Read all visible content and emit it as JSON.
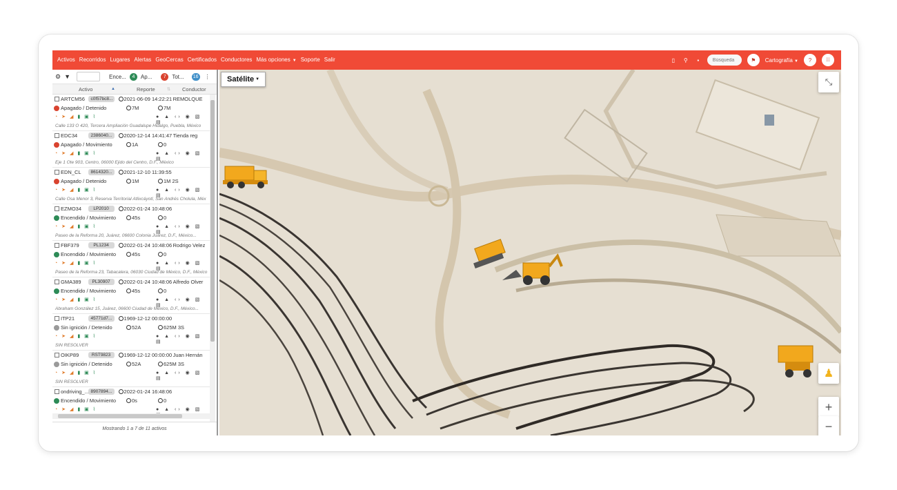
{
  "menu": {
    "items": [
      "Activos",
      "Recorridos",
      "Lugares",
      "Alertas",
      "GeoCercas",
      "Certificados",
      "Conductores",
      "Más opciones",
      "Soporte",
      "Salir"
    ],
    "search_placeholder": "Búsqueda",
    "cartografia": "Cartografía"
  },
  "filters": {
    "encendidos_label": "Ence...",
    "encendidos_count": "4",
    "apagados_label": "Ap...",
    "apagados_count": "7",
    "total_label": "Tot...",
    "total_count": "16"
  },
  "columns": {
    "activo": "Activo",
    "reporte": "Reporte",
    "conductor": "Conductor"
  },
  "assets": [
    {
      "name": "ARTCM56",
      "plate": "c0f57bc8...",
      "report": "2021-06-09 14:22:21",
      "driver": "REMOLQUE",
      "status": "Apagado / Detenido",
      "status_color": "#d9432f",
      "t1": "7M",
      "t2": "7M",
      "address": "Calle 133 O 420, Tercera Ampliación Guadalupe Hidalgo, Puebla, México"
    },
    {
      "name": "EDC34",
      "plate": "2386040...",
      "report": "2020-12-14 14:41:47",
      "driver": "Tienda reg",
      "status": "Apagado / Movimiento",
      "status_color": "#d9432f",
      "t1": "1A",
      "t2": "0",
      "address": "Eje 1 Ote 903, Centro, 06000 Ejido del Centro, D.F., México"
    },
    {
      "name": "EDN_CL",
      "plate": "8614320...",
      "report": "2021-12-10 11:39:55",
      "driver": "",
      "status": "Apagado / Detenido",
      "status_color": "#d9432f",
      "t1": "1M",
      "t2": "1M 2S",
      "address": "Calle Osa Menor 3, Reserva Territorial Atlixcáyotl, San Andrés Cholula, Méx"
    },
    {
      "name": "EZMO34",
      "plate": "LP2010",
      "report": "2022-01-24 10:48:06",
      "driver": "",
      "status": "Encendido / Movimiento",
      "status_color": "#2e8b57",
      "t1": "45s",
      "t2": "0",
      "address": "Paseo de la Reforma 20, Juárez, 06600 Colonia Juárez, D.F., México..."
    },
    {
      "name": "FBF379",
      "plate": "PL1234",
      "report": "2022-01-24 10:48:06",
      "driver": "Rodrigo Velez",
      "status": "Encendido / Movimiento",
      "status_color": "#2e8b57",
      "t1": "45s",
      "t2": "0",
      "address": "Paseo de la Reforma 23, Tabacalera, 06030 Ciudad de México, D.F., México"
    },
    {
      "name": "GMA389",
      "plate": "PL30907",
      "report": "2022-01-24 10:48:06",
      "driver": "Alfredo Olver",
      "status": "Encendido / Movimiento",
      "status_color": "#2e8b57",
      "t1": "45s",
      "t2": "0",
      "address": "Abraham González 15, Juárez, 06600 Ciudad de México, D.F., México..."
    },
    {
      "name": "ITP21",
      "plate": "45771d7...",
      "report": "1969-12-12 00:00:00",
      "driver": "",
      "status": "Sin ignición / Detenido",
      "status_color": "#9a9a9a",
      "t1": "52A",
      "t2": "625M 3S",
      "address": "SIN RESOLVER"
    },
    {
      "name": "OIKP89",
      "plate": "RST9823",
      "report": "1969-12-12 00:00:00",
      "driver": "Juan Hernán",
      "status": "Sin ignición / Detenido",
      "status_color": "#9a9a9a",
      "t1": "52A",
      "t2": "625M 3S",
      "address": "SIN RESOLVER"
    },
    {
      "name": "ondriving_...",
      "plate": "8907894...",
      "report": "2022-01-24 16:48:06",
      "driver": "",
      "status": "Encendido / Movimiento",
      "status_color": "#2e8b57",
      "t1": "0s",
      "t2": "0",
      "address": ""
    }
  ],
  "footer": "Mostrando 1 a 7 de 11 activos",
  "map": {
    "type_label": "Satélite"
  }
}
